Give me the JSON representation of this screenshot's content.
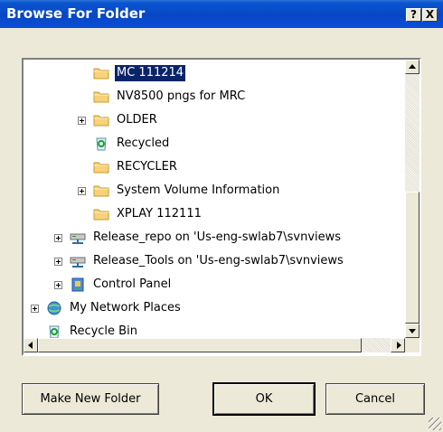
{
  "window": {
    "title": "Browse For Folder",
    "help_label": "?",
    "close_label": "X"
  },
  "tree": {
    "items": [
      {
        "label": "MC 111214",
        "icon": "folder-icon",
        "selected": true
      },
      {
        "label": "NV8500 pngs for MRC",
        "icon": "folder-icon"
      },
      {
        "label": "OLDER",
        "icon": "folder-icon",
        "expandable": true
      },
      {
        "label": "Recycled",
        "icon": "recycle-bin-icon"
      },
      {
        "label": "RECYCLER",
        "icon": "folder-icon"
      },
      {
        "label": "System Volume Information",
        "icon": "folder-icon",
        "expandable": true
      },
      {
        "label": "XPLAY 112111",
        "icon": "folder-icon"
      },
      {
        "label": "Release_repo on 'Us-eng-swlab7\\svnviews",
        "icon": "network-drive-icon",
        "expandable": true
      },
      {
        "label": "Release_Tools on 'Us-eng-swlab7\\svnviews",
        "icon": "network-drive-icon",
        "expandable": true
      },
      {
        "label": "Control Panel",
        "icon": "control-panel-icon",
        "expandable": true
      },
      {
        "label": "My Network Places",
        "icon": "network-places-icon",
        "expandable": true
      },
      {
        "label": "Recycle Bin",
        "icon": "recycle-bin-icon"
      }
    ]
  },
  "buttons": {
    "new_folder": "Make New Folder",
    "ok": "OK",
    "cancel": "Cancel"
  },
  "colors": {
    "title_bar": "#0846c4",
    "selection": "#0a246a",
    "dialog_bg": "#ece9d8"
  }
}
